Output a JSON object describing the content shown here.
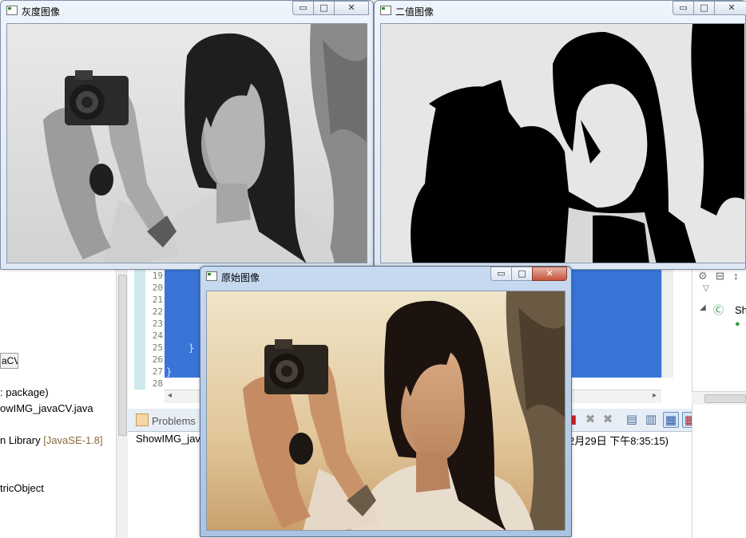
{
  "windows": {
    "gray": {
      "title": "灰度图像"
    },
    "binary": {
      "title": "二值图像"
    },
    "original": {
      "title": "原始图像"
    },
    "caption_buttons": {
      "minimize": "▭",
      "maximize": "□",
      "close": "✕"
    }
  },
  "package_explorer": {
    "items": [
      {
        "label": "aCV"
      },
      {
        "label": ": package)"
      },
      {
        "label": "owIMG_javaCV.java"
      },
      {
        "label": "n Library ",
        "tag": "[JavaSE-1.8]"
      },
      {
        "label": "tricObject"
      }
    ]
  },
  "editor": {
    "line_numbers": [
      "19",
      "20",
      "21",
      "22",
      "23",
      "24",
      "25",
      "26",
      "27",
      "28"
    ],
    "brace_inner": "}",
    "brace_outer": "}"
  },
  "console": {
    "tab_label": "Problems",
    "launch_prefix": "ShowIMG_javi",
    "launch_time": "2月29日 下午8:35:15)"
  },
  "outline": {
    "items": [
      {
        "label": "Sh"
      }
    ]
  },
  "colors": {
    "selection": "#3875d7",
    "gutter": "#cfe9ef",
    "window_frame": "#dde7f3"
  }
}
